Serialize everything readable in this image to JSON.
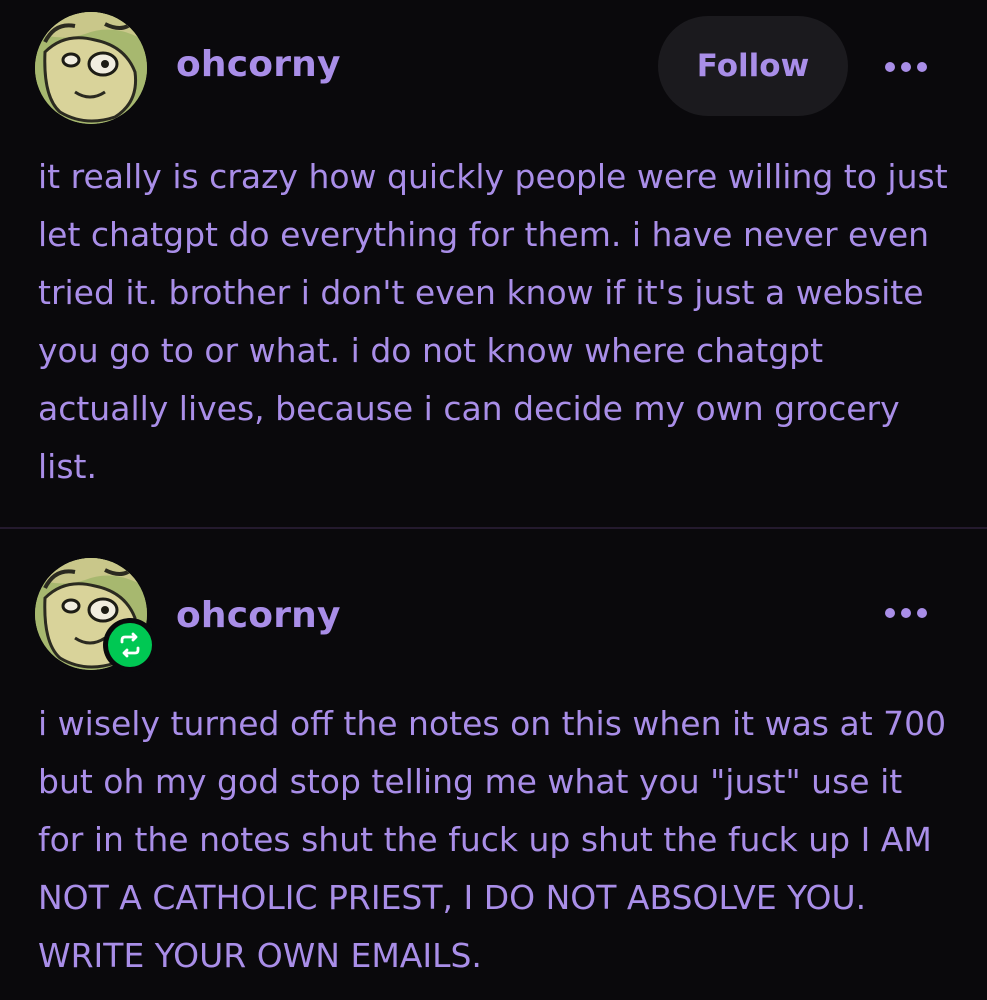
{
  "posts": [
    {
      "username": "ohcorny",
      "follow_label": "Follow",
      "more_icon": "ellipsis-icon",
      "body": "it really is crazy how quickly people were willing to just let chatgpt do everything for them. i have never even tried it. brother i don't even know if it's just a website you go to or what. i do not know where chatgpt actually lives, because i can decide my own grocery list."
    },
    {
      "username": "ohcorny",
      "reblog_icon": "reblog-icon",
      "more_icon": "ellipsis-icon",
      "body": "i wisely turned off the notes on this when it was at 700 but oh my god stop telling me what you \"just\" use it for in the notes shut the fuck up shut the fuck up I AM NOT A CATHOLIC PRIEST, I DO NOT ABSOLVE YOU. WRITE YOUR OWN EMAILS."
    }
  ],
  "colors": {
    "background": "#0a090c",
    "accent_text": "#a98ee8",
    "follow_button_bg": "#1b1a1e",
    "reblog_green": "#00c853",
    "divider": "#241a2e"
  }
}
